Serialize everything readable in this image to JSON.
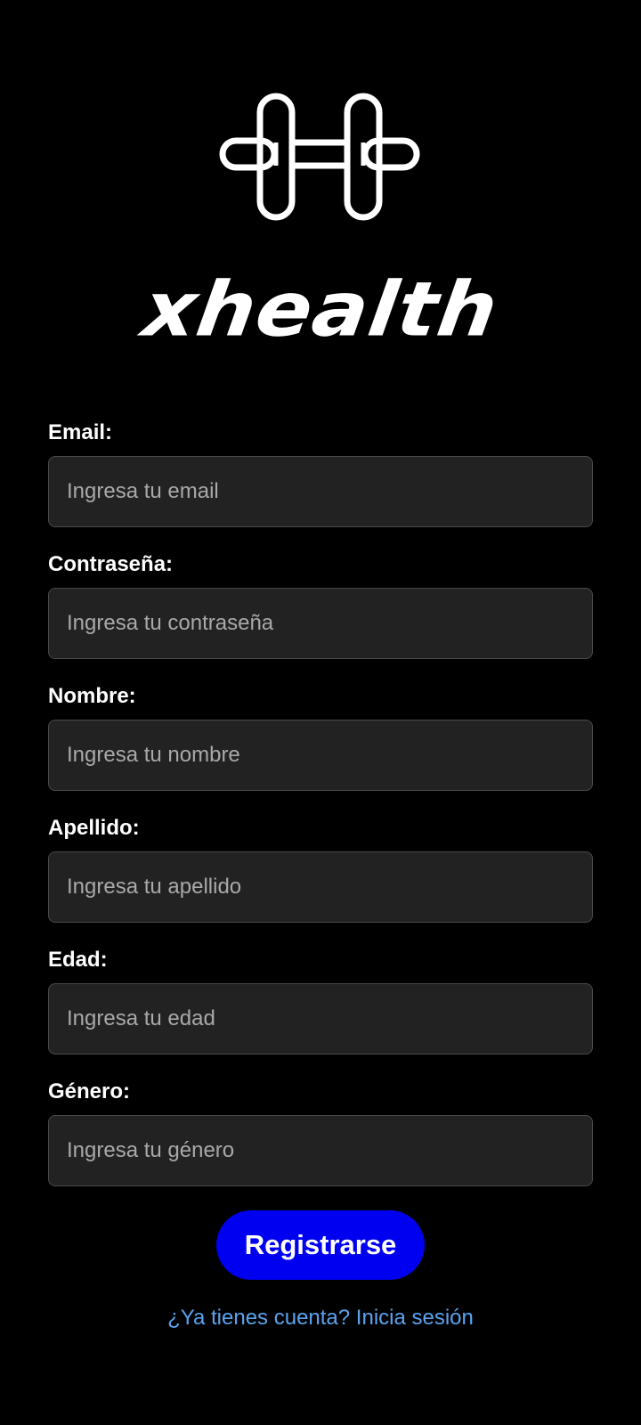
{
  "brand": {
    "logo_icon": "dumbbell-icon",
    "name": "xhealth"
  },
  "form": {
    "fields": [
      {
        "label": "Email:",
        "placeholder": "Ingresa tu email"
      },
      {
        "label": "Contraseña:",
        "placeholder": "Ingresa tu contraseña"
      },
      {
        "label": "Nombre:",
        "placeholder": "Ingresa tu nombre"
      },
      {
        "label": "Apellido:",
        "placeholder": "Ingresa tu apellido"
      },
      {
        "label": "Edad:",
        "placeholder": "Ingresa tu edad"
      },
      {
        "label": "Género:",
        "placeholder": "Ingresa tu género"
      }
    ],
    "submit_label": "Registrarse",
    "login_link": "¿Ya tienes cuenta? Inicia sesión"
  },
  "colors": {
    "background": "#000000",
    "input_background": "#222222",
    "button_primary": "#0000f0",
    "link": "#5ba3f0"
  }
}
